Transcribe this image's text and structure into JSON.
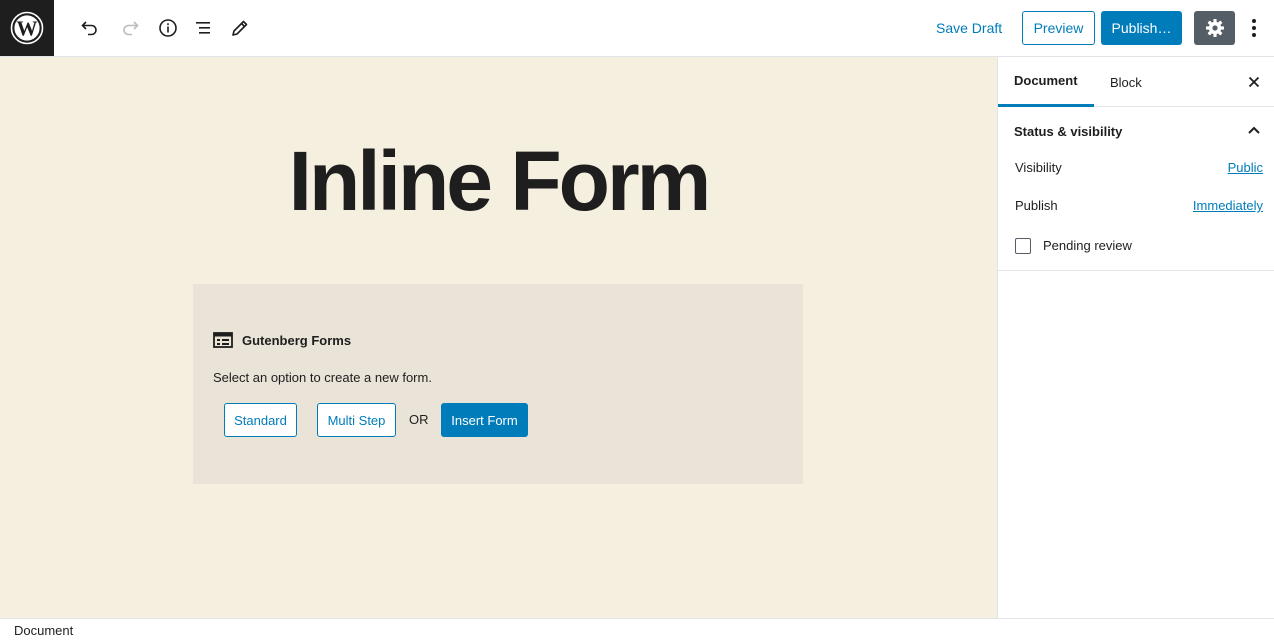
{
  "toolbar": {
    "logo_icon": "wordpress-logo-icon",
    "tools": [
      "undo-icon",
      "redo-icon",
      "info-icon",
      "block-navigation-icon",
      "edit-mode-icon"
    ],
    "save_draft": "Save Draft",
    "preview": "Preview",
    "publish": "Publish…",
    "settings_icon": "gear-icon",
    "more_icon": "more-vertical-icon"
  },
  "post": {
    "title": "Inline Form"
  },
  "form_block": {
    "icon": "form-icon",
    "title": "Gutenberg Forms",
    "instructions": "Select an option to create a new form.",
    "standard_label": "Standard",
    "multistep_label": "Multi Step",
    "or_label": "OR",
    "insert_label": "Insert Form"
  },
  "sidebar": {
    "tabs": [
      {
        "label": "Document",
        "active": true
      },
      {
        "label": "Block",
        "active": false
      }
    ],
    "panel": {
      "title": "Status & visibility",
      "expanded": true,
      "visibility_label": "Visibility",
      "visibility_value": "Public",
      "publish_label": "Publish",
      "publish_value": "Immediately",
      "pending_label": "Pending review",
      "pending_checked": false
    }
  },
  "footer": {
    "breadcrumb": "Document"
  },
  "colors": {
    "accent": "#007cba",
    "canvas_bg": "#f5efe0",
    "block_bg": "#eae3d7",
    "dark": "#1e1e1e"
  }
}
